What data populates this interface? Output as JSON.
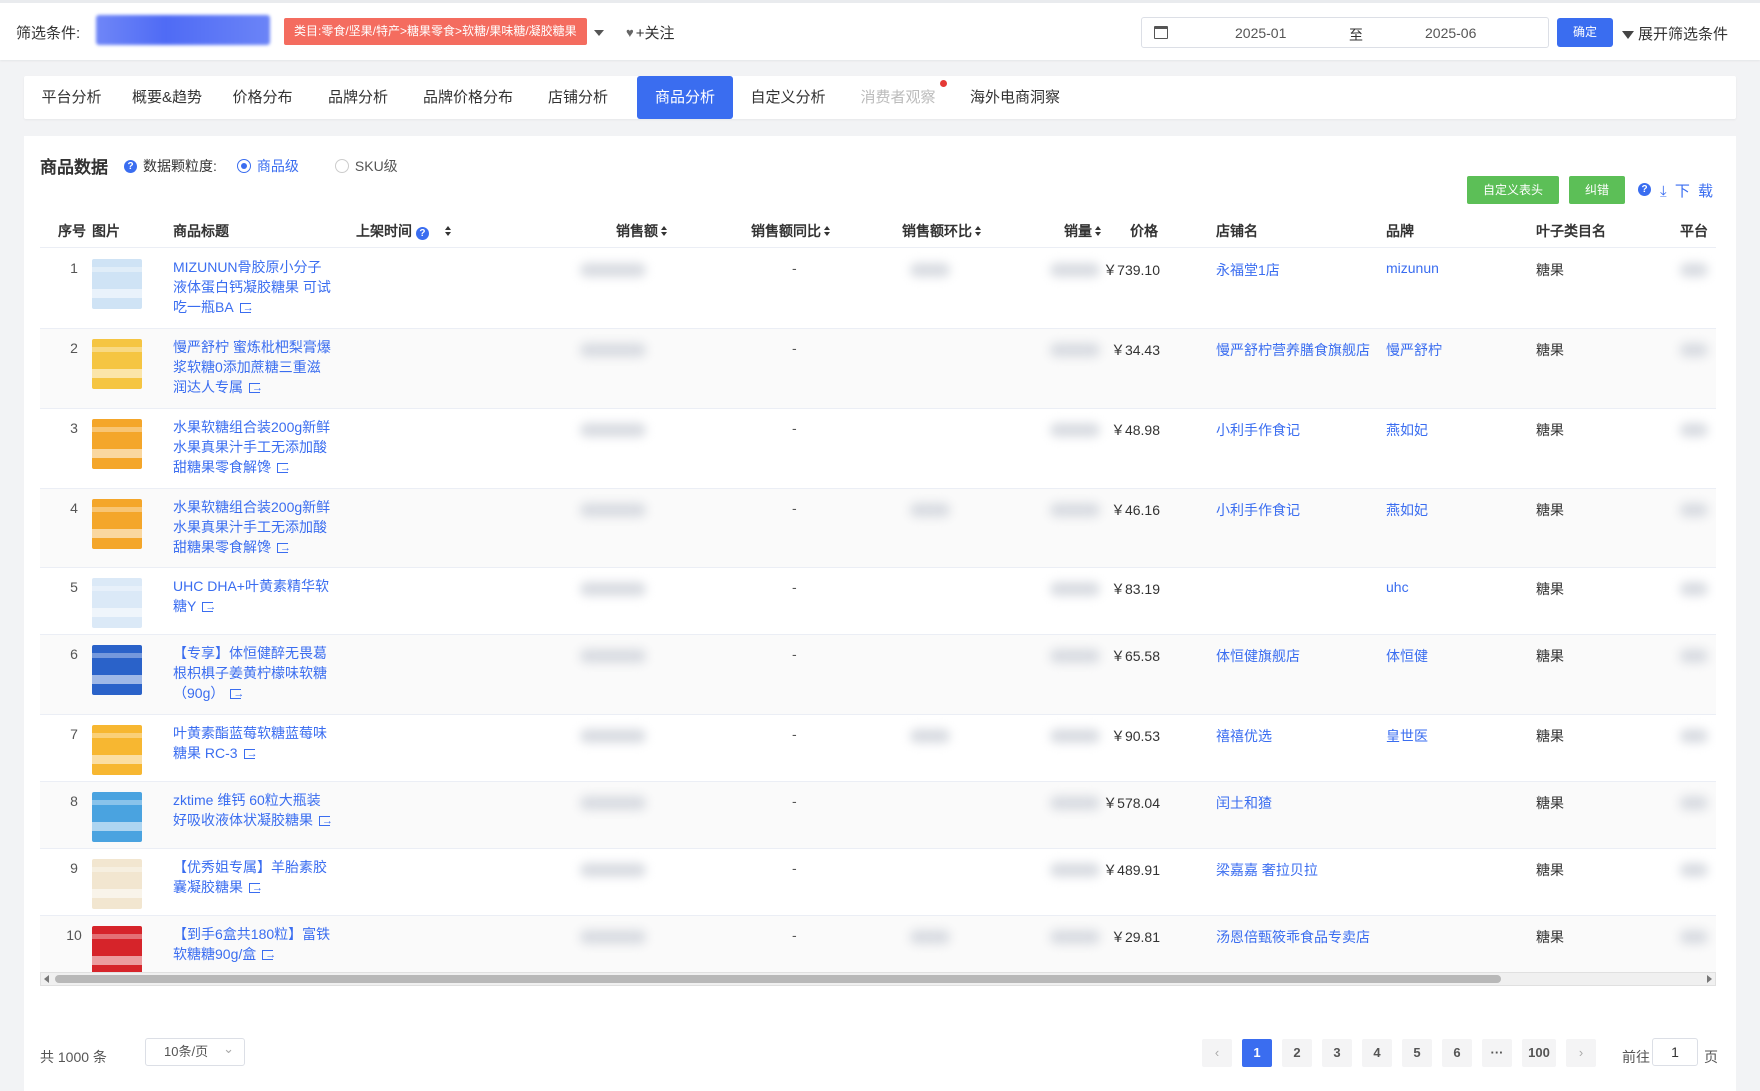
{
  "filter": {
    "label": "筛选条件:",
    "category_tag": "类目:零食/坚果/特产>糖果零食>软糖/果味糖/凝胶糖果",
    "follow": "+关注",
    "date_from": "2025-01",
    "date_sep": "至",
    "date_to": "2025-06",
    "confirm": "确定",
    "expand": "展开筛选条件"
  },
  "tabs": [
    {
      "label": "平台分析"
    },
    {
      "label": "概要&趋势"
    },
    {
      "label": "价格分布"
    },
    {
      "label": "品牌分析"
    },
    {
      "label": "品牌价格分布"
    },
    {
      "label": "店铺分析"
    },
    {
      "label": "商品分析"
    },
    {
      "label": "自定义分析"
    },
    {
      "label": "消费者观察"
    },
    {
      "label": "海外电商洞察"
    }
  ],
  "active_tab": "商品分析",
  "panel": {
    "title": "商品数据",
    "granularity_label": "数据颗粒度:",
    "opt_product": "商品级",
    "opt_sku": "SKU级",
    "btn_custom_header": "自定义表头",
    "btn_correct": "纠错",
    "download": "下 载"
  },
  "columns": {
    "idx": "序号",
    "img": "图片",
    "title": "商品标题",
    "listed": "上架时间",
    "sales": "销售额",
    "yoy": "销售额同比",
    "mom": "销售额环比",
    "volume": "销量",
    "price": "价格",
    "shop": "店铺名",
    "brand": "品牌",
    "leaf": "叶子类目名",
    "platform": "平台"
  },
  "rows": [
    {
      "idx": "1",
      "title": "MIZUNUN骨胶原小分子液体蛋白钙凝胶糖果 可试吃一瓶BA",
      "yoy": "-",
      "price": "￥739.10",
      "shop": "永福堂1店",
      "brand": "mizunun",
      "leaf": "糖果"
    },
    {
      "idx": "2",
      "title": "慢严舒柠 蜜炼枇杷梨膏爆浆软糖0添加蔗糖三重滋润达人专属",
      "yoy": "-",
      "price": "￥34.43",
      "shop": "慢严舒柠营养膳食旗舰店",
      "brand": "慢严舒柠",
      "leaf": "糖果"
    },
    {
      "idx": "3",
      "title": "水果软糖组合装200g新鲜水果真果汁手工无添加酸甜糖果零食解馋",
      "yoy": "-",
      "price": "￥48.98",
      "shop": "小利手作食记",
      "brand": "燕如妃",
      "leaf": "糖果"
    },
    {
      "idx": "4",
      "title": "水果软糖组合装200g新鲜水果真果汁手工无添加酸甜糖果零食解馋",
      "yoy": "-",
      "price": "￥46.16",
      "shop": "小利手作食记",
      "brand": "燕如妃",
      "leaf": "糖果"
    },
    {
      "idx": "5",
      "title": "UHC DHA+叶黄素精华软糖Y",
      "yoy": "-",
      "price": "￥83.19",
      "shop": "",
      "brand": "uhc",
      "leaf": "糖果"
    },
    {
      "idx": "6",
      "title": "【专享】体恒健醉无畏葛根枳椇子姜黄柠檬味软糖（90g）",
      "yoy": "-",
      "price": "￥65.58",
      "shop": "体恒健旗舰店",
      "brand": "体恒健",
      "leaf": "糖果"
    },
    {
      "idx": "7",
      "title": "叶黄素酯蓝莓软糖蓝莓味糖果 RC-3",
      "yoy": "-",
      "price": "￥90.53",
      "shop": "禧禧优选",
      "brand": "皇世医",
      "leaf": "糖果"
    },
    {
      "idx": "8",
      "title": "zktime 维钙 60粒大瓶装好吸收液体状凝胶糖果",
      "yoy": "-",
      "price": "￥578.04",
      "shop": "闰土和猹",
      "brand": "",
      "leaf": "糖果"
    },
    {
      "idx": "9",
      "title": "【优秀姐专属】羊胎素胶囊凝胶糖果",
      "yoy": "-",
      "price": "￥489.91",
      "shop": "梁嘉嘉 奢拉贝拉",
      "brand": "",
      "leaf": "糖果"
    },
    {
      "idx": "10",
      "title": "【到手6盒共180粒】富铁软糖糖90g/盒",
      "yoy": "-",
      "price": "￥29.81",
      "shop": "汤恩倍甄筱乖食品专卖店",
      "brand": "",
      "leaf": "糖果"
    }
  ],
  "thumb_colors": [
    "#cfe3f5",
    "#f5c542",
    "#f4a62a",
    "#f4a62a",
    "#dbe9f7",
    "#2a62c9",
    "#f7b731",
    "#4aa3e0",
    "#f2e6d0",
    "#d6242a"
  ],
  "pagination": {
    "total": "共 1000 条",
    "page_size": "10条/页",
    "pages": [
      "1",
      "2",
      "3",
      "4",
      "5",
      "6",
      "···",
      "100"
    ],
    "prev": "‹",
    "next": "›",
    "goto_prefix": "前往",
    "goto_value": "1",
    "goto_suffix": "页"
  }
}
